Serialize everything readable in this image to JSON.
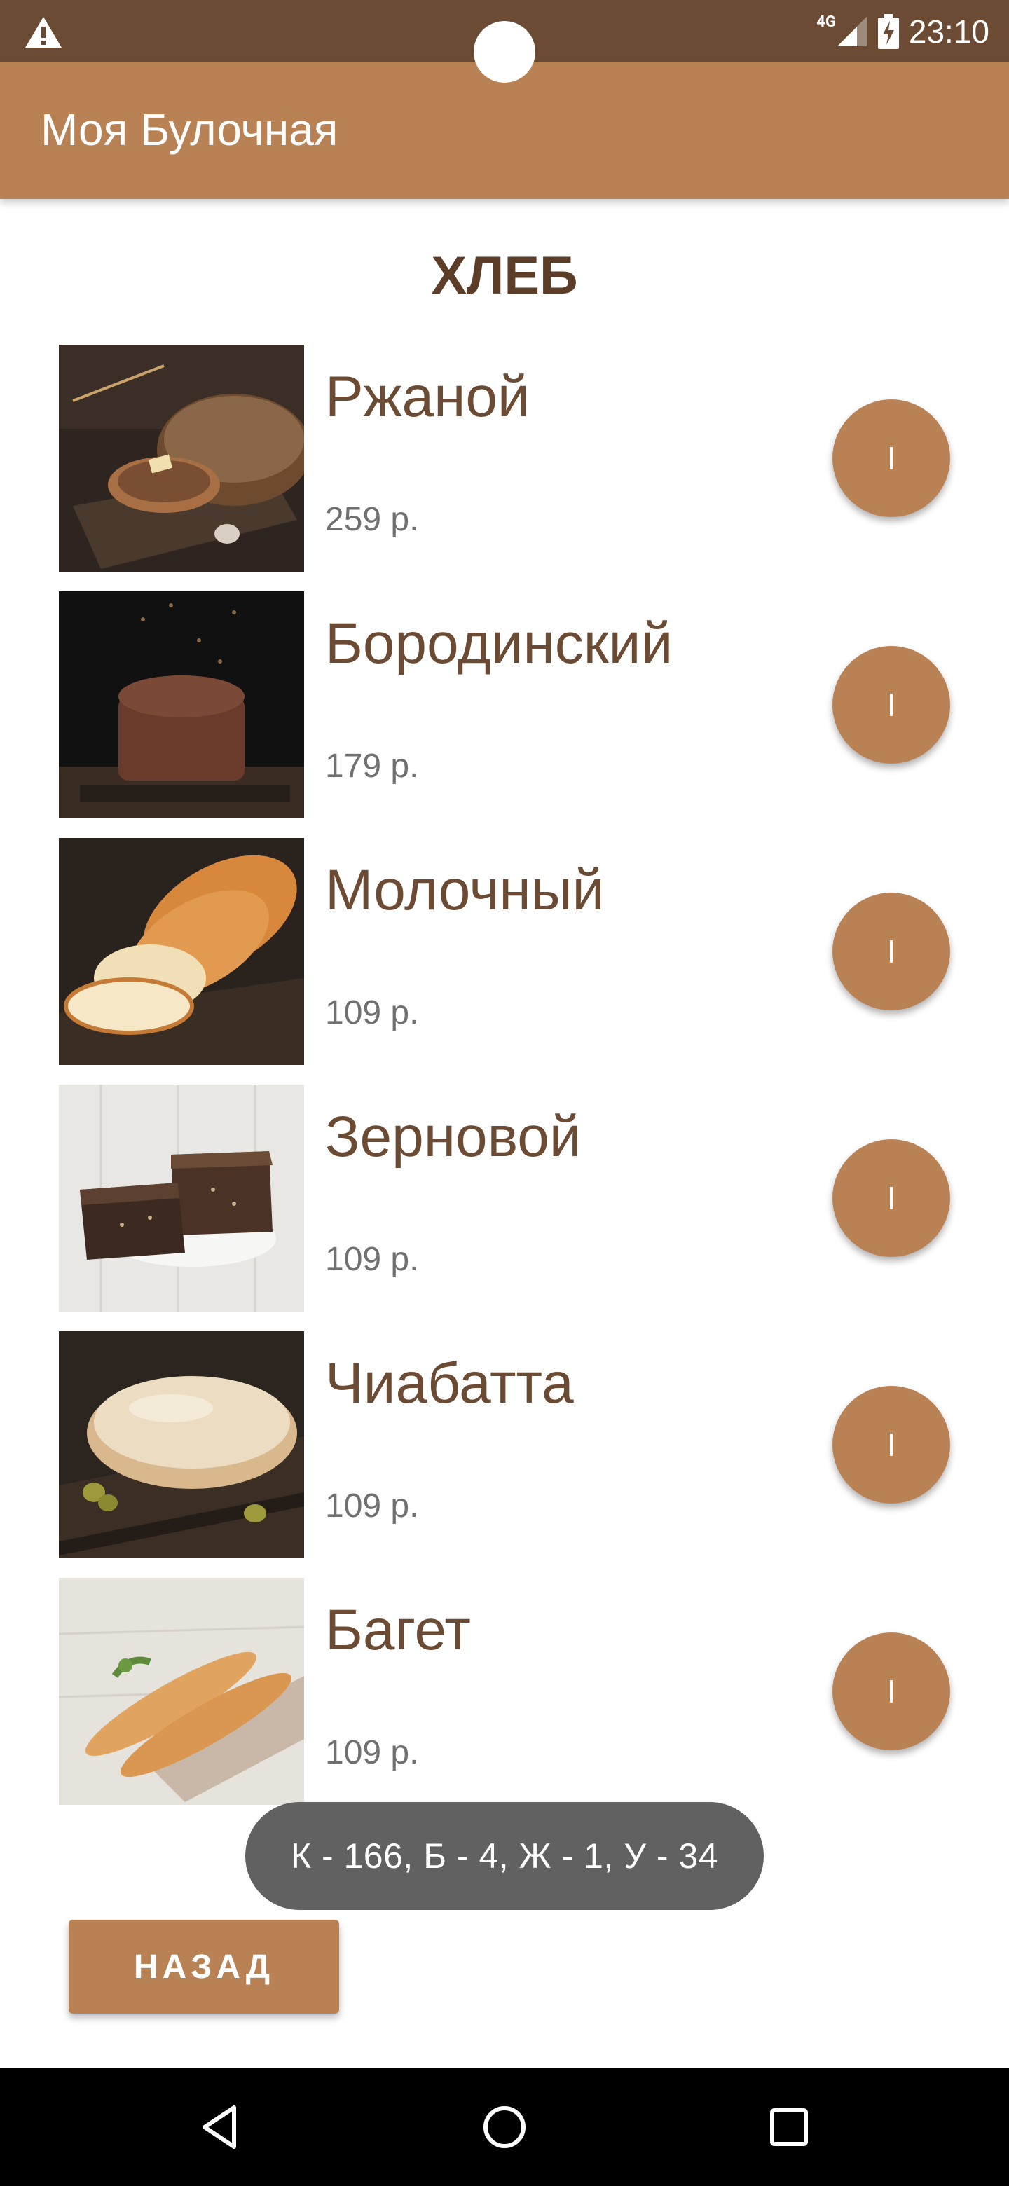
{
  "status_bar": {
    "network": "4G",
    "time": "23:10",
    "icons": [
      "warning-icon",
      "signal-icon",
      "battery-charging-icon"
    ]
  },
  "app_bar": {
    "title": "Моя Булочная"
  },
  "section": {
    "title": "ХЛЕБ"
  },
  "products": [
    {
      "name": "Ржаной",
      "price": "259 р.",
      "image": "rye-bread-photo"
    },
    {
      "name": "Бородинский",
      "price": "179 р.",
      "image": "borodinsky-bread-photo"
    },
    {
      "name": "Молочный",
      "price": "109 р.",
      "image": "milk-bread-photo"
    },
    {
      "name": "Зерновой",
      "price": "109 р.",
      "image": "grain-bread-photo"
    },
    {
      "name": "Чиабатта",
      "price": "109 р.",
      "image": "ciabatta-photo"
    },
    {
      "name": "Багет",
      "price": "109 р.",
      "image": "baguette-photo"
    }
  ],
  "toast": {
    "text": "К - 166, Б - 4, Ж - 1, У - 34"
  },
  "back_button": {
    "label": "НАЗАД"
  },
  "nav_bar": {
    "icons": [
      "back-triangle-icon",
      "home-circle-icon",
      "recents-square-icon"
    ]
  },
  "colors": {
    "status_bar": "#6b4b33",
    "accent": "#b88255",
    "title_text": "#5b3d28",
    "price_text": "#707070",
    "toast_bg": "#616161"
  }
}
